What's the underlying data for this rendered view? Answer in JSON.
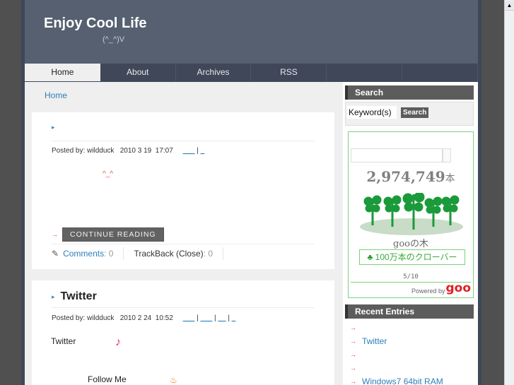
{
  "header": {
    "title": "Enjoy Cool Life",
    "tagline": "(^_^)V"
  },
  "nav": {
    "items": [
      {
        "label": "Home",
        "active": true
      },
      {
        "label": "About"
      },
      {
        "label": "Archives"
      },
      {
        "label": "RSS"
      },
      {
        "label": ""
      },
      {
        "label": ""
      }
    ]
  },
  "breadcrumb": "Home",
  "posts": [
    {
      "title": "",
      "meta_prefix": "Posted by: wildduck   2010 3 19  17:07",
      "meta_links": [
        "___",
        "_"
      ],
      "body_emoji": "^_^",
      "continue_label": "CONTINUE READING",
      "comments_label": "Comments",
      "comments_count": "0",
      "trackback_label": "TrackBack (Close)",
      "trackback_count": "0"
    },
    {
      "title": "Twitter",
      "meta_prefix": "Posted by: wildduck   2010 2 24  10:52",
      "meta_links": [
        "___",
        "___",
        "__",
        "_"
      ],
      "body_text": "Twitter",
      "body_text_2": "Follow Me"
    }
  ],
  "sidebar": {
    "search": {
      "heading": "Search",
      "input_value": "Keyword(s)",
      "button_label": "Search"
    },
    "goo_widget": {
      "count": "2,974,749",
      "count_unit": "本",
      "name": "gooの木",
      "banner": "100万本のクローバー",
      "page": "5/10",
      "powered_by": "Powered by",
      "logo": "goo"
    },
    "recent": {
      "heading": "Recent Entries",
      "items": [
        "",
        "Twitter",
        "",
        "",
        "Windows7 64bit  RAM"
      ]
    }
  },
  "colors": {
    "header_bg": "#566070",
    "nav_bg": "#3f4758",
    "link": "#2c7fb8",
    "accent_pink": "#e0307a",
    "goo_green": "#7fcf7f",
    "goo_red": "#e02020"
  }
}
